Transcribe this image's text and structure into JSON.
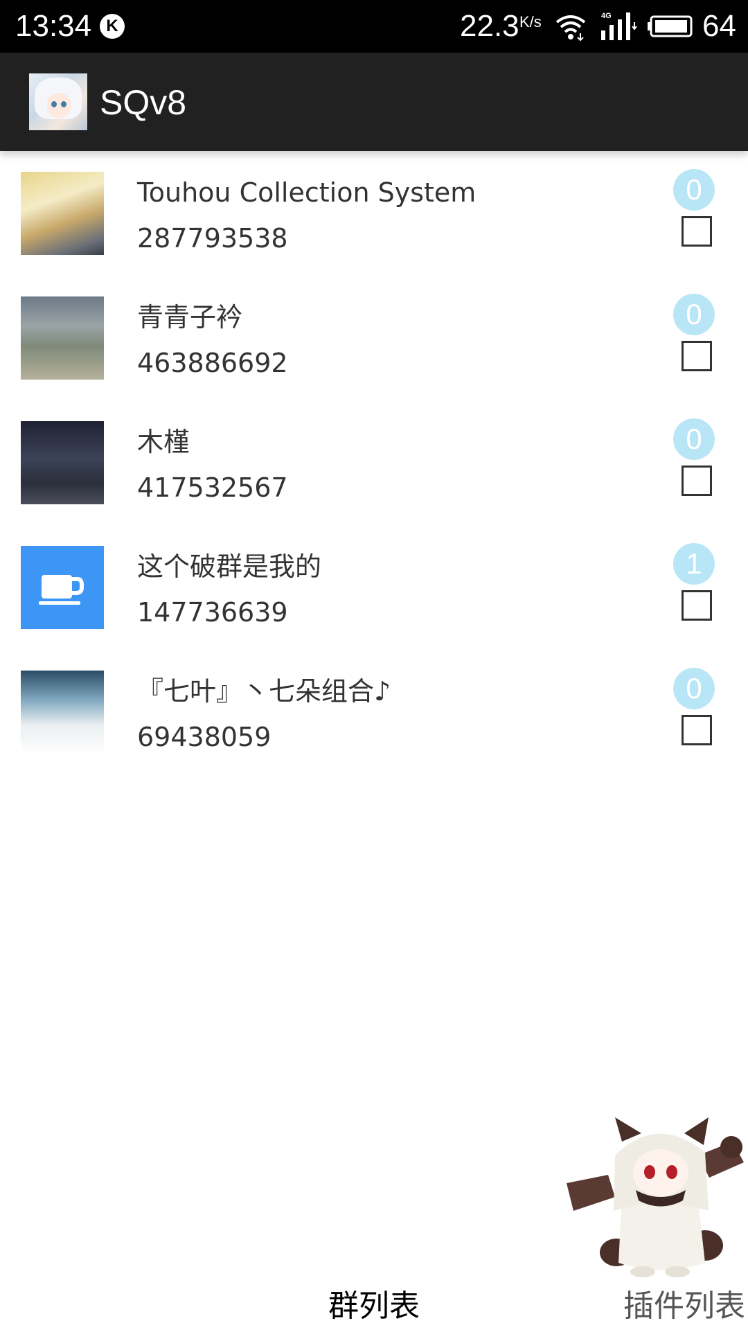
{
  "status_bar": {
    "time": "13:34",
    "k_badge": "K",
    "network_speed": "22.3",
    "network_speed_unit": "K/s",
    "network_type": "4G",
    "battery_level": "64",
    "icons": [
      "k-notification-icon",
      "wifi-icon",
      "signal-4g-icon",
      "battery-icon"
    ]
  },
  "app_bar": {
    "title": "SQv8"
  },
  "groups": [
    {
      "name": "Touhou Collection System",
      "number": "287793538",
      "badge": "0",
      "checked": false
    },
    {
      "name": "青青子衿",
      "number": "463886692",
      "badge": "0",
      "checked": false
    },
    {
      "name": "木槿",
      "number": "417532567",
      "badge": "0",
      "checked": false
    },
    {
      "name": "这个破群是我的",
      "number": "147736639",
      "badge": "1",
      "checked": false
    },
    {
      "name": "『七叶』丶七朵组合♪",
      "number": "69438059",
      "badge": "0",
      "checked": false
    }
  ],
  "tabs": {
    "groups_label": "群列表",
    "plugins_label": "插件列表",
    "active": "群列表"
  },
  "colors": {
    "status_bar_bg": "#000000",
    "app_bar_bg": "#212121",
    "badge_bg": "#b8e6f7",
    "default_avatar_bg": "#3d96f5",
    "text": "#333333"
  }
}
